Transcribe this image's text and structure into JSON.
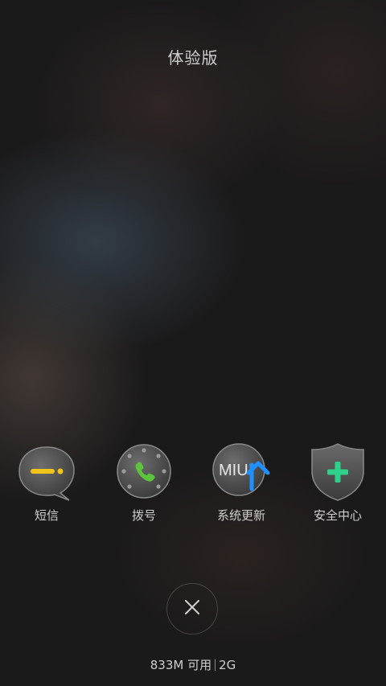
{
  "header": {
    "title": "体验版"
  },
  "apps": [
    {
      "label": "短信",
      "icon": "message-icon",
      "accent": "#f0c419"
    },
    {
      "label": "拨号",
      "icon": "phone-dial-icon",
      "accent": "#5cc53b"
    },
    {
      "label": "系统更新",
      "icon": "miui-update-icon",
      "icon_text": "MIUI",
      "accent": "#1e90ff"
    },
    {
      "label": "安全中心",
      "icon": "security-shield-icon",
      "accent": "#2fd08a"
    }
  ],
  "footer": {
    "close_icon": "close-icon",
    "memory": "833M 可用",
    "network": "2G"
  }
}
